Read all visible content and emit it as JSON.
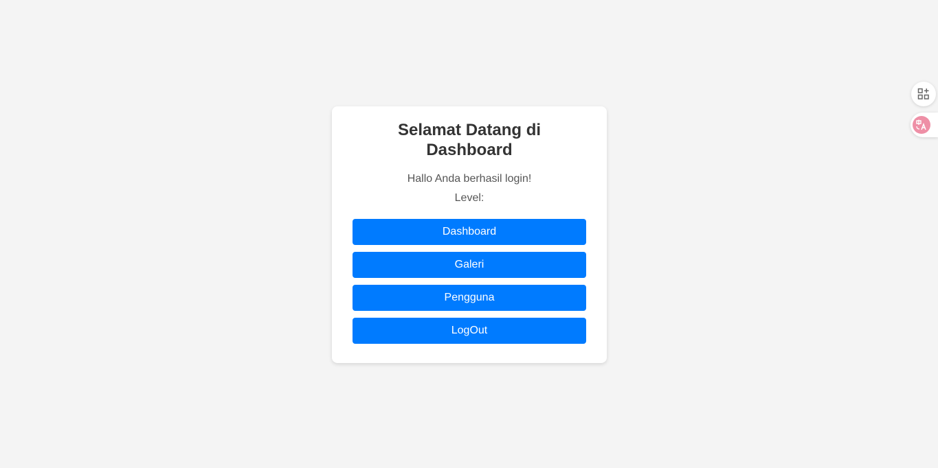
{
  "card": {
    "title": "Selamat Datang di Dashboard",
    "greeting": "Hallo Anda berhasil login!",
    "level_label": "Level:"
  },
  "menu": {
    "items": [
      {
        "label": "Dashboard"
      },
      {
        "label": "Galeri"
      },
      {
        "label": "Pengguna"
      },
      {
        "label": "LogOut"
      }
    ]
  },
  "floating": {
    "apps_icon": "apps-add-icon",
    "translate_icon": "translate-icon"
  },
  "colors": {
    "background": "#f4f4f4",
    "card": "#ffffff",
    "button": "#007bff",
    "button_text": "#ffffff",
    "title_text": "#333333",
    "body_text": "#555555",
    "translate_accent": "#ee8fa6"
  }
}
